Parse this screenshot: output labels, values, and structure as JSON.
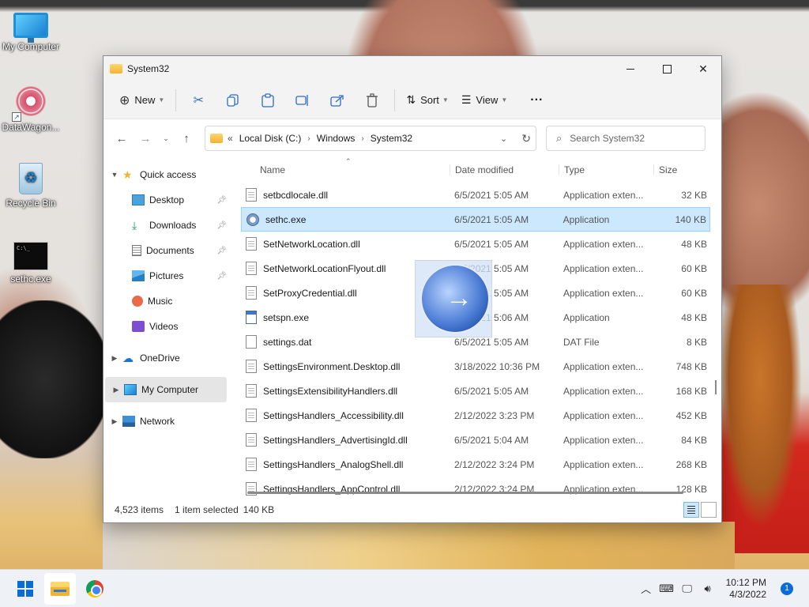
{
  "desktop": {
    "icons": [
      {
        "label": "My Computer",
        "icon": "monitor-icon"
      },
      {
        "label": "DataWagon...",
        "icon": "datawagon-icon"
      },
      {
        "label": "Recycle Bin",
        "icon": "recycle-bin-icon"
      },
      {
        "label": "sethc.exe",
        "icon": "cmd-icon"
      }
    ]
  },
  "window": {
    "title": "System32",
    "toolbar": {
      "new_label": "New",
      "sort_label": "Sort",
      "view_label": "View",
      "more_label": "···"
    },
    "address": {
      "overflow": "«",
      "crumbs": [
        "Local Disk (C:)",
        "Windows",
        "System32"
      ]
    },
    "search": {
      "placeholder": "Search System32"
    },
    "nav": {
      "quick_access": "Quick access",
      "items": [
        "Desktop",
        "Downloads",
        "Documents",
        "Pictures",
        "Music",
        "Videos"
      ],
      "onedrive": "OneDrive",
      "my_computer": "My Computer",
      "network": "Network"
    },
    "columns": {
      "name": "Name",
      "date": "Date modified",
      "type": "Type",
      "size": "Size"
    },
    "files": [
      {
        "name": "setbcdlocale.dll",
        "date": "6/5/2021 5:05 AM",
        "type": "Application exten...",
        "size": "32 KB",
        "kind": "dll"
      },
      {
        "name": "sethc.exe",
        "date": "6/5/2021 5:05 AM",
        "type": "Application",
        "size": "140 KB",
        "kind": "app",
        "selected": true
      },
      {
        "name": "SetNetworkLocation.dll",
        "date": "6/5/2021 5:05 AM",
        "type": "Application exten...",
        "size": "48 KB",
        "kind": "dll"
      },
      {
        "name": "SetNetworkLocationFlyout.dll",
        "date": "6/5/2021 5:05 AM",
        "type": "Application exten...",
        "size": "60 KB",
        "kind": "dll"
      },
      {
        "name": "SetProxyCredential.dll",
        "date": "6/5/2021 5:05 AM",
        "type": "Application exten...",
        "size": "60 KB",
        "kind": "dll"
      },
      {
        "name": "setspn.exe",
        "date": "6/5/2021 5:06 AM",
        "type": "Application",
        "size": "48 KB",
        "kind": "exe"
      },
      {
        "name": "settings.dat",
        "date": "6/5/2021 5:05 AM",
        "type": "DAT File",
        "size": "8 KB",
        "kind": "dat"
      },
      {
        "name": "SettingsEnvironment.Desktop.dll",
        "date": "3/18/2022 10:36 PM",
        "type": "Application exten...",
        "size": "748 KB",
        "kind": "dll"
      },
      {
        "name": "SettingsExtensibilityHandlers.dll",
        "date": "6/5/2021 5:05 AM",
        "type": "Application exten...",
        "size": "168 KB",
        "kind": "dll"
      },
      {
        "name": "SettingsHandlers_Accessibility.dll",
        "date": "2/12/2022 3:23 PM",
        "type": "Application exten...",
        "size": "452 KB",
        "kind": "dll"
      },
      {
        "name": "SettingsHandlers_AdvertisingId.dll",
        "date": "6/5/2021 5:04 AM",
        "type": "Application exten...",
        "size": "84 KB",
        "kind": "dll"
      },
      {
        "name": "SettingsHandlers_AnalogShell.dll",
        "date": "2/12/2022 3:24 PM",
        "type": "Application exten...",
        "size": "268 KB",
        "kind": "dll"
      },
      {
        "name": "SettingsHandlers_AppControl.dll",
        "date": "2/12/2022 3:24 PM",
        "type": "Application exten...",
        "size": "128 KB",
        "kind": "dll"
      }
    ],
    "status": {
      "count": "4,523 items",
      "selection": "1 item selected",
      "size": "140 KB"
    }
  },
  "taskbar": {
    "time": "10:12 PM",
    "date": "4/3/2022",
    "notifications": "1"
  }
}
